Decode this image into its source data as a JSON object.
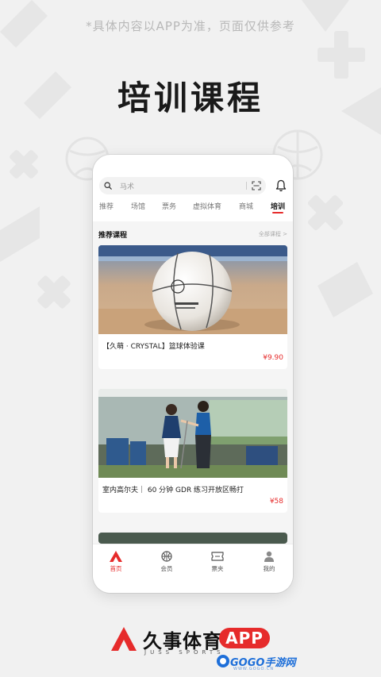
{
  "disclaimer": "*具体内容以APP为准，页面仅供参考",
  "hero_title": "培训课程",
  "search": {
    "placeholder": "马术"
  },
  "tabs": [
    {
      "label": "推荐"
    },
    {
      "label": "场馆"
    },
    {
      "label": "票务"
    },
    {
      "label": "虚拟体育"
    },
    {
      "label": "商城"
    },
    {
      "label": "培训",
      "active": true
    }
  ],
  "section": {
    "title": "推荐课程",
    "more": "全部课程 >"
  },
  "courses": [
    {
      "title": "【久萌 · CRYSTAL】篮球体验课",
      "price": "¥9.90",
      "image": "basketball-photo"
    },
    {
      "title": "室内高尔夫｜ 60 分钟 GDR 练习开放区畅打",
      "price": "¥58",
      "image": "indoor-golf-photo"
    }
  ],
  "bottom_nav": [
    {
      "label": "首页",
      "icon": "home-logo-icon",
      "active": true
    },
    {
      "label": "会员",
      "icon": "member-ball-icon"
    },
    {
      "label": "票夹",
      "icon": "ticket-icon"
    },
    {
      "label": "我的",
      "icon": "person-icon"
    }
  ],
  "brand": {
    "name": "久事体育",
    "sub": "JUSS SPORTS",
    "app": "APP"
  },
  "watermark": {
    "text": "GOGO手游网",
    "sub": "WWW.GOGO.CN"
  },
  "colors": {
    "accent": "#e62b2b",
    "watermark": "#1e6fd9"
  }
}
